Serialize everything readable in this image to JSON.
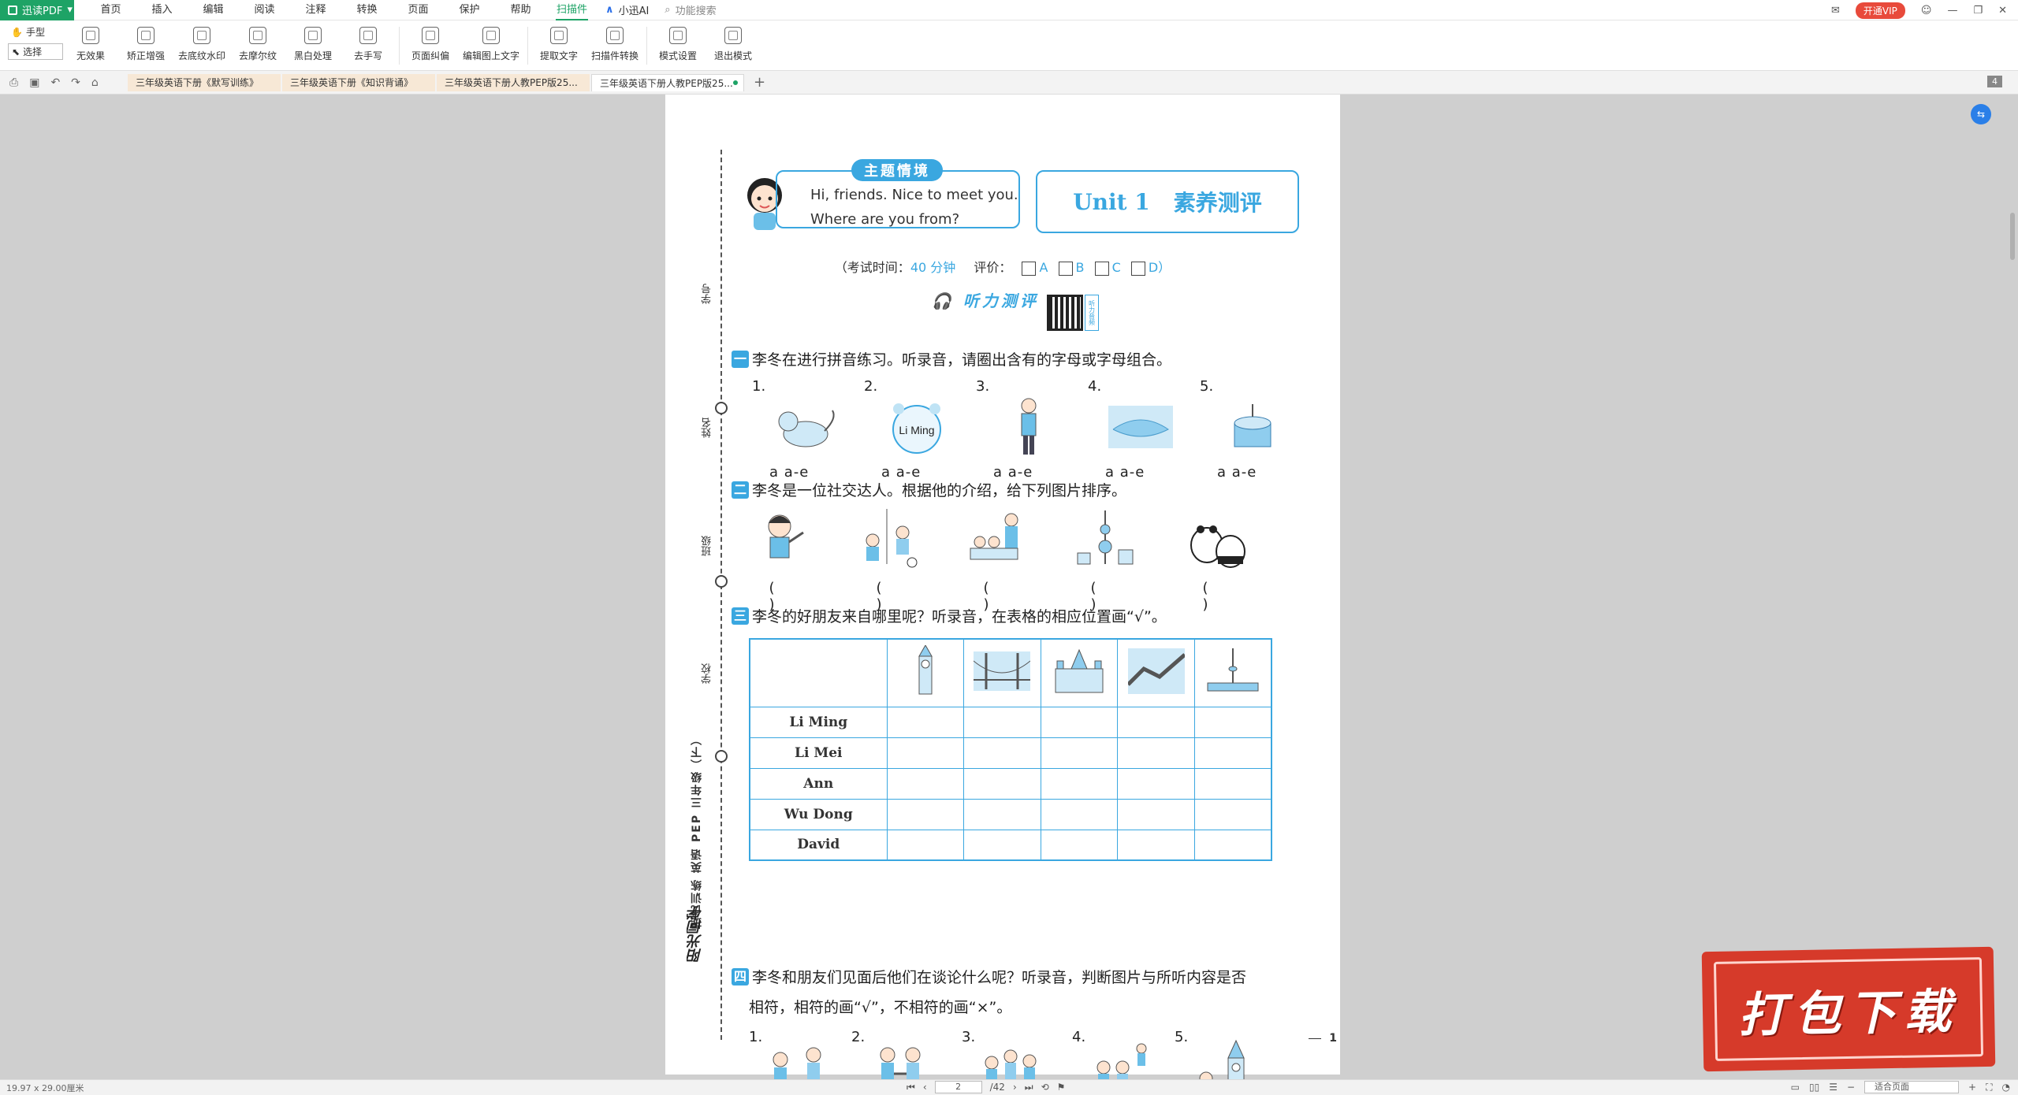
{
  "app": {
    "brand": "迅读PDF",
    "menu": [
      "首页",
      "插入",
      "编辑",
      "阅读",
      "注释",
      "转换",
      "页面",
      "保护",
      "帮助",
      "扫描件"
    ],
    "menu_active_index": 9,
    "ai": "小迅AI",
    "feature_search": "功能搜索",
    "vip": "开通VIP"
  },
  "toolbar": {
    "modes": [
      "手型",
      "选择"
    ],
    "tools": [
      "无效果",
      "矫正增强",
      "去底纹水印",
      "去摩尔纹",
      "黑白处理",
      "去手写",
      "页面纠偏",
      "编辑图上文字",
      "提取文字",
      "扫描件转换",
      "模式设置",
      "退出模式"
    ]
  },
  "tabs": [
    "三年级英语下册《默写训练》",
    "三年级英语下册《知识背诵》",
    "三年级英语下册人教PEP版25...",
    "三年级英语下册人教PEP版25..."
  ],
  "page_count_badge": "4",
  "doc": {
    "theme_tag": "主题情境",
    "theme_line1": "Hi, friends. Nice to meet you.",
    "theme_line2": "Where are you from?",
    "unit": "Unit 1",
    "unit_title": "素养测评",
    "exam_prefix": "（考试时间：",
    "exam_time": "40 分钟",
    "exam_rating": "评价：",
    "grades": [
      "A",
      "B",
      "C",
      "D）"
    ],
    "listen_title": "听力测评",
    "qr_side": "听力音频",
    "side_labels": [
      "学号",
      "姓名",
      "班级",
      "学校"
    ],
    "side_title": "提优训练 英语 PEP 三年级（下）",
    "side_brand": "阳光同学",
    "q1": {
      "num": "一",
      "text": "李冬在进行拼音练习。听录音，请圈出含有的字母或字母组合。",
      "items": [
        {
          "n": "1.",
          "opts": "a  a-e"
        },
        {
          "n": "2.",
          "opts": "a  a-e",
          "label": "Li Ming"
        },
        {
          "n": "3.",
          "opts": "a  a-e"
        },
        {
          "n": "4.",
          "opts": "a  a-e"
        },
        {
          "n": "5.",
          "opts": "a  a-e"
        }
      ]
    },
    "q2": {
      "num": "二",
      "text": "李冬是一位社交达人。根据他的介绍，给下列图片排序。",
      "paren": "( )"
    },
    "q3": {
      "num": "三",
      "text": "李冬的好朋友来自哪里呢？听录音，在表格的相应位置画“√”。",
      "names": [
        "Li Ming",
        "Li Mei",
        "Ann",
        "Wu Dong",
        "David"
      ]
    },
    "q4": {
      "num": "四",
      "text": "李冬和朋友们见面后他们在谈论什么呢？听录音，判断图片与所听内容是否",
      "text2": "相符，相符的画“√”，不相符的画“×”。",
      "items": [
        "1.",
        "2.",
        "3.",
        "4.",
        "5."
      ],
      "paren": "( )"
    },
    "page_number": "1"
  },
  "stamp": "打包下载",
  "status": {
    "size": "19.97 x 29.00厘米",
    "current_page": "2",
    "total_pages": "/42",
    "zoom_mode": "适合页面"
  }
}
